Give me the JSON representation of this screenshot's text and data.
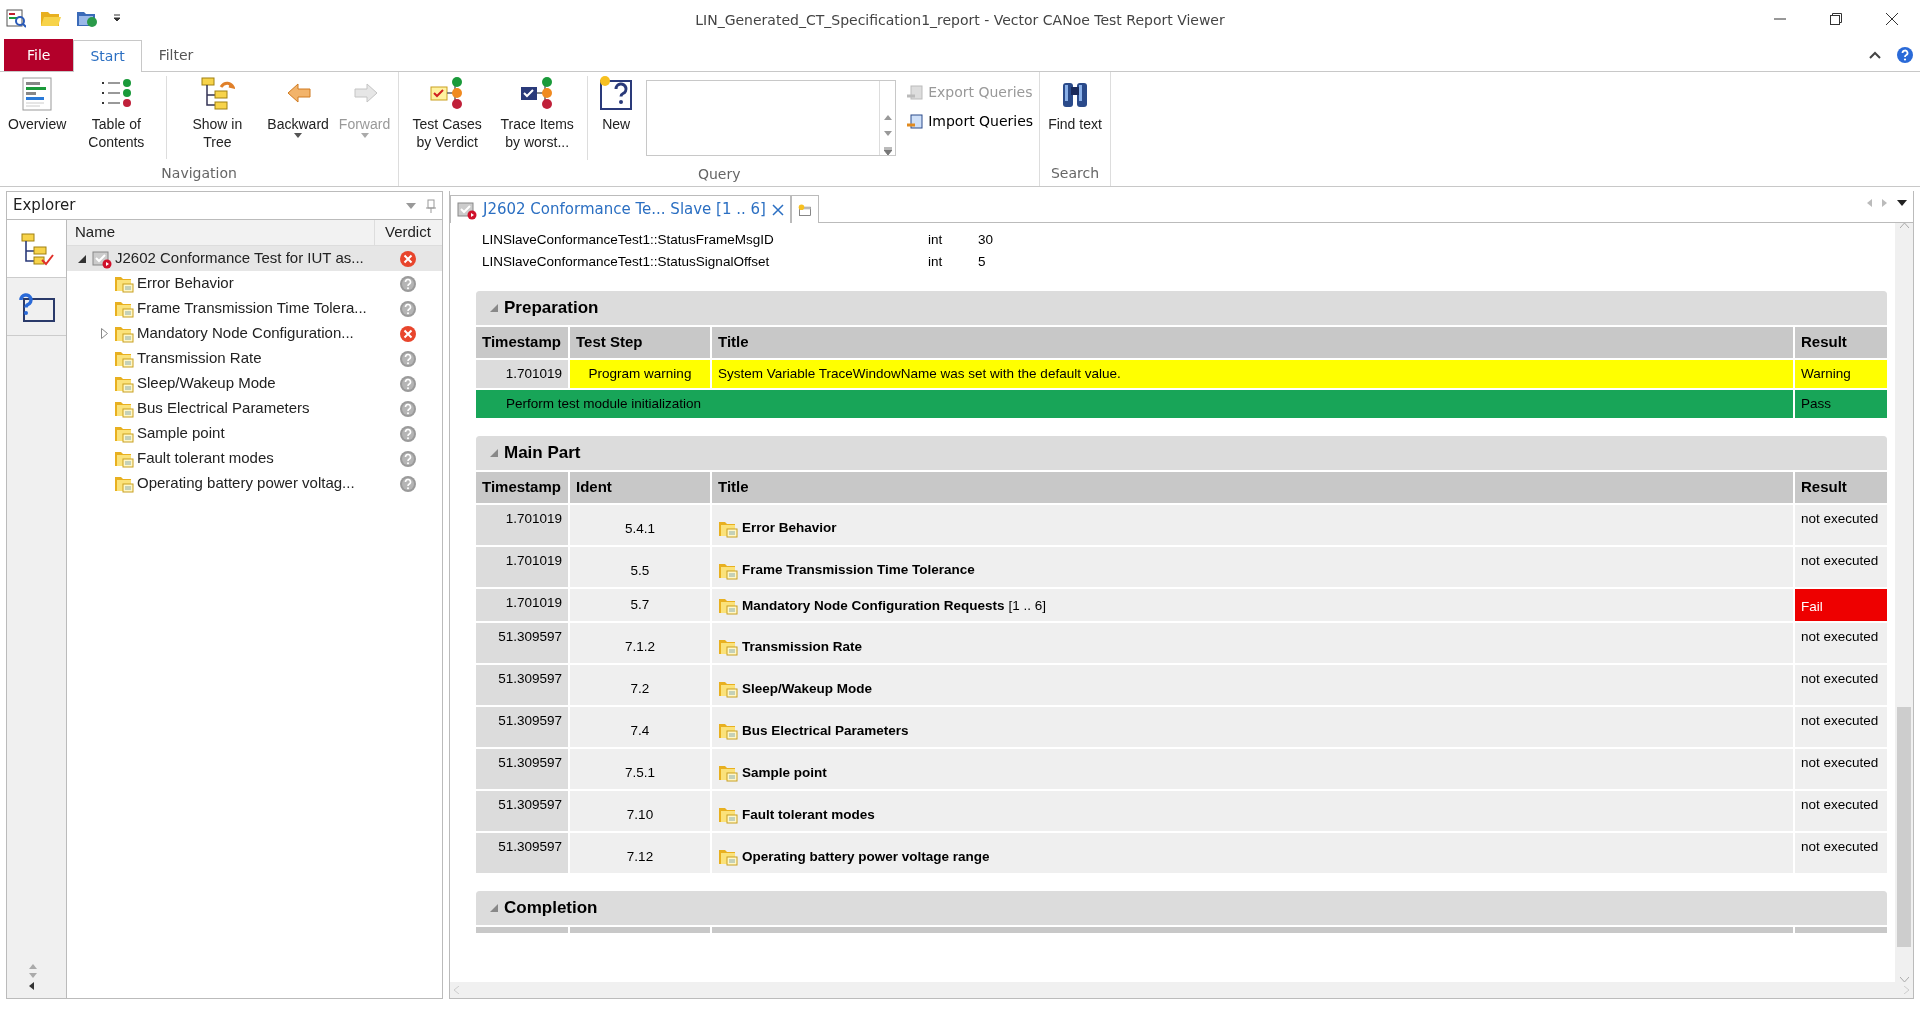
{
  "window": {
    "title": "LIN_Generated_CT_Specification1_report - Vector CANoe Test Report Viewer"
  },
  "ribbon": {
    "tabs": [
      {
        "label": "File",
        "kind": "file",
        "selected": false
      },
      {
        "label": "Start",
        "kind": "tab",
        "selected": true
      },
      {
        "label": "Filter",
        "kind": "tab",
        "selected": false
      }
    ],
    "groups": [
      {
        "label": "Navigation",
        "buttons": [
          {
            "label": "Overview",
            "disabled": false,
            "dropdown": false
          },
          {
            "label": "Table of Contents",
            "disabled": false,
            "dropdown": false
          },
          {
            "label": "Show in Tree",
            "disabled": false,
            "dropdown": false
          },
          {
            "label": "Backward",
            "disabled": false,
            "dropdown": true
          },
          {
            "label": "Forward",
            "disabled": true,
            "dropdown": true
          }
        ]
      },
      {
        "label": "Query",
        "buttons": [
          {
            "label": "Test Cases by Verdict",
            "disabled": false,
            "dropdown": false
          },
          {
            "label": "Trace Items by worst...",
            "disabled": false,
            "dropdown": false
          },
          {
            "label": "New",
            "disabled": false,
            "dropdown": false
          }
        ],
        "side_actions": [
          {
            "label": "Export Queries",
            "disabled": true
          },
          {
            "label": "Import Queries",
            "disabled": false
          }
        ]
      },
      {
        "label": "Search",
        "buttons": [
          {
            "label": "Find text",
            "disabled": false,
            "dropdown": false
          }
        ]
      }
    ]
  },
  "explorer": {
    "title": "Explorer",
    "columns": [
      "Name",
      "Verdict"
    ],
    "tree": [
      {
        "label": "J2602 Conformance Test for IUT as...",
        "failed": true,
        "expanded": true,
        "selected": true,
        "children": [
          {
            "label": "Error Behavior",
            "failed": false,
            "expandable": false,
            "selected": false
          },
          {
            "label": "Frame Transmission Time Tolera...",
            "failed": false,
            "expandable": false,
            "selected": false
          },
          {
            "label": "Mandatory Node Configuration...",
            "failed": true,
            "expandable": true,
            "selected": false
          },
          {
            "label": "Transmission Rate",
            "failed": false,
            "expandable": false,
            "selected": false
          },
          {
            "label": "Sleep/Wakeup Mode",
            "failed": false,
            "expandable": false,
            "selected": false
          },
          {
            "label": "Bus Electrical Parameters",
            "failed": false,
            "expandable": false,
            "selected": false
          },
          {
            "label": "Sample point",
            "failed": false,
            "expandable": false,
            "selected": false
          },
          {
            "label": "Fault tolerant modes",
            "failed": false,
            "expandable": false,
            "selected": false
          },
          {
            "label": "Operating battery power voltag...",
            "failed": false,
            "expandable": false,
            "selected": false
          }
        ]
      }
    ]
  },
  "document_tab": {
    "title": "J2602 Conformance Te... Slave [1 .. 6]"
  },
  "variables": [
    {
      "name": "LINSlaveConformanceTest1::StatusFrameMsgID",
      "type": "int",
      "value": "30"
    },
    {
      "name": "LINSlaveConformanceTest1::StatusSignalOffset",
      "type": "int",
      "value": "5"
    }
  ],
  "sections": [
    {
      "title": "Preparation",
      "columns": [
        "Timestamp",
        "Test Step",
        "Title",
        "Result"
      ],
      "rows": [
        {
          "kind": "step",
          "timestamp": "1.701019",
          "step": "Program warning",
          "title": "System Variable TraceWindowName was set with the default value.",
          "result": "Warning",
          "color": "#ffff00"
        },
        {
          "kind": "summary",
          "title": "Perform test module initialization",
          "result": "Pass",
          "color": "#18a558"
        }
      ]
    },
    {
      "title": "Main Part",
      "columns": [
        "Timestamp",
        "Ident",
        "Title",
        "Result"
      ],
      "rows": [
        {
          "kind": "testcase",
          "timestamp": "1.701019",
          "ident": "5.4.1",
          "title": "Error Behavior",
          "result": "not executed"
        },
        {
          "kind": "testcase",
          "timestamp": "1.701019",
          "ident": "5.5",
          "title": "Frame Transmission Time Tolerance",
          "result": "not executed"
        },
        {
          "kind": "testcase",
          "timestamp": "1.701019",
          "ident": "5.7",
          "title": "Mandatory Node Configuration Requests",
          "range": "[1 .. 6]",
          "result": "Fail",
          "color": "#ee0000"
        },
        {
          "kind": "testcase",
          "timestamp": "51.309597",
          "ident": "7.1.2",
          "title": "Transmission Rate",
          "result": "not executed"
        },
        {
          "kind": "testcase",
          "timestamp": "51.309597",
          "ident": "7.2",
          "title": "Sleep/Wakeup Mode",
          "result": "not executed"
        },
        {
          "kind": "testcase",
          "timestamp": "51.309597",
          "ident": "7.4",
          "title": "Bus Electrical Parameters",
          "result": "not executed"
        },
        {
          "kind": "testcase",
          "timestamp": "51.309597",
          "ident": "7.5.1",
          "title": "Sample point",
          "result": "not executed"
        },
        {
          "kind": "testcase",
          "timestamp": "51.309597",
          "ident": "7.10",
          "title": "Fault tolerant modes",
          "result": "not executed"
        },
        {
          "kind": "testcase",
          "timestamp": "51.309597",
          "ident": "7.12",
          "title": "Operating battery power voltage range",
          "result": "not executed"
        }
      ]
    },
    {
      "title": "Completion"
    }
  ]
}
